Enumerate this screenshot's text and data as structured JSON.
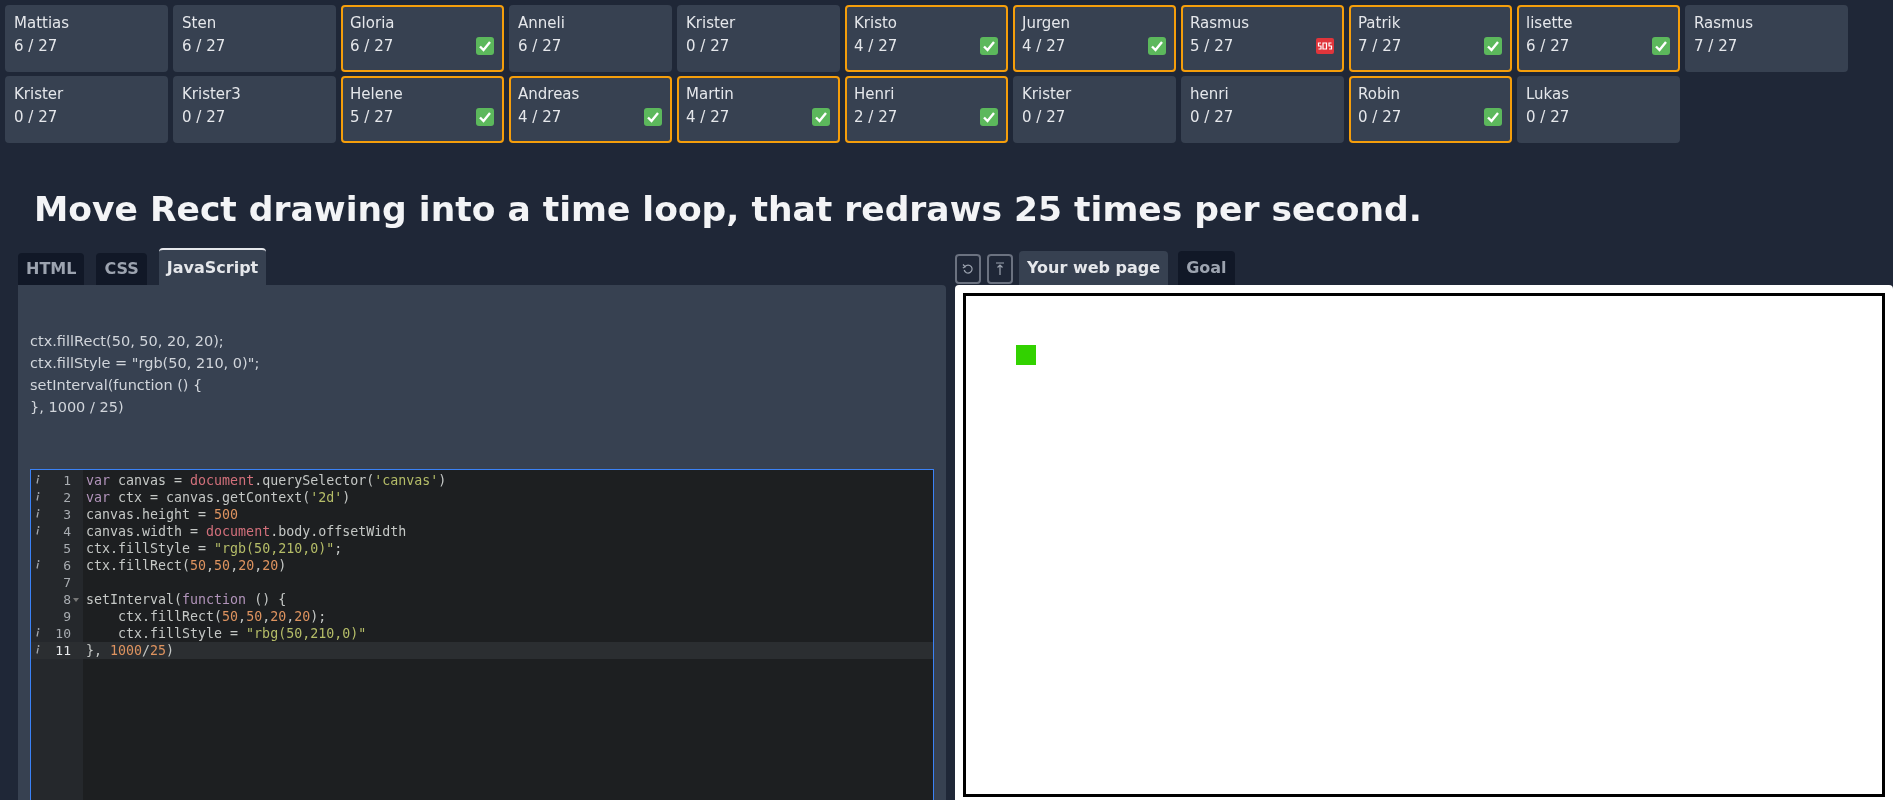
{
  "students": [
    {
      "name": "Mattias",
      "score": "6 / 27",
      "done": false,
      "help": false
    },
    {
      "name": "Sten",
      "score": "6 / 27",
      "done": false,
      "help": false
    },
    {
      "name": "Gloria",
      "score": "6 / 27",
      "done": true,
      "help": false
    },
    {
      "name": "Anneli",
      "score": "6 / 27",
      "done": false,
      "help": false
    },
    {
      "name": "Krister",
      "score": "0 / 27",
      "done": false,
      "help": false
    },
    {
      "name": "Kristo",
      "score": "4 / 27",
      "done": true,
      "help": false
    },
    {
      "name": "Jurgen",
      "score": "4 / 27",
      "done": true,
      "help": false
    },
    {
      "name": "Rasmus",
      "score": "5 / 27",
      "done": false,
      "help": true
    },
    {
      "name": "Patrik",
      "score": "7 / 27",
      "done": true,
      "help": false
    },
    {
      "name": "lisette",
      "score": "6 / 27",
      "done": true,
      "help": false
    },
    {
      "name": "Rasmus",
      "score": "7 / 27",
      "done": false,
      "help": false
    },
    {
      "name": "Krister",
      "score": "0 / 27",
      "done": false,
      "help": false
    },
    {
      "name": "Krister3",
      "score": "0 / 27",
      "done": false,
      "help": false
    },
    {
      "name": "Helene",
      "score": "5 / 27",
      "done": true,
      "help": false
    },
    {
      "name": "Andreas",
      "score": "4 / 27",
      "done": true,
      "help": false
    },
    {
      "name": "Martin",
      "score": "4 / 27",
      "done": true,
      "help": false
    },
    {
      "name": "Henri",
      "score": "2 / 27",
      "done": true,
      "help": false
    },
    {
      "name": "Krister",
      "score": "0 / 27",
      "done": false,
      "help": false
    },
    {
      "name": "henri",
      "score": "0 / 27",
      "done": false,
      "help": false
    },
    {
      "name": "Robin",
      "score": "0 / 27",
      "done": true,
      "help": false
    },
    {
      "name": "Lukas",
      "score": "0 / 27",
      "done": false,
      "help": false
    }
  ],
  "task_title": "Move Rect drawing into a time loop, that redraws 25 times per second.",
  "editor_tabs": [
    {
      "label": "HTML",
      "selected": false
    },
    {
      "label": "CSS",
      "selected": false
    },
    {
      "label": "JavaScript",
      "selected": true
    }
  ],
  "snippet": [
    "ctx.fillRect(50, 50, 20, 20);",
    "ctx.fillStyle = \"rgb(50, 210, 0)\";",
    "setInterval(function () {",
    "}, 1000 / 25)"
  ],
  "code_lines": [
    {
      "number": "1",
      "info": true,
      "fold": false,
      "active": false,
      "tokens": [
        {
          "kind": "keyword",
          "text": "var"
        },
        {
          "kind": "plain",
          "text": " canvas = "
        },
        {
          "kind": "builtin",
          "text": "document"
        },
        {
          "kind": "plain",
          "text": ".querySelector("
        },
        {
          "kind": "string",
          "text": "'canvas'"
        },
        {
          "kind": "plain",
          "text": ")"
        }
      ]
    },
    {
      "number": "2",
      "info": true,
      "fold": false,
      "active": false,
      "tokens": [
        {
          "kind": "keyword",
          "text": "var"
        },
        {
          "kind": "plain",
          "text": " ctx = canvas.getContext("
        },
        {
          "kind": "string",
          "text": "'2d'"
        },
        {
          "kind": "plain",
          "text": ")"
        }
      ]
    },
    {
      "number": "3",
      "info": true,
      "fold": false,
      "active": false,
      "tokens": [
        {
          "kind": "plain",
          "text": "canvas.height = "
        },
        {
          "kind": "number",
          "text": "500"
        }
      ]
    },
    {
      "number": "4",
      "info": true,
      "fold": false,
      "active": false,
      "tokens": [
        {
          "kind": "plain",
          "text": "canvas.width = "
        },
        {
          "kind": "builtin",
          "text": "document"
        },
        {
          "kind": "plain",
          "text": ".body.offsetWidth"
        }
      ]
    },
    {
      "number": "5",
      "info": false,
      "fold": false,
      "active": false,
      "tokens": [
        {
          "kind": "plain",
          "text": "ctx.fillStyle = "
        },
        {
          "kind": "string",
          "text": "\"rgb(50,210,0)\""
        },
        {
          "kind": "plain",
          "text": ";"
        }
      ]
    },
    {
      "number": "6",
      "info": true,
      "fold": false,
      "active": false,
      "tokens": [
        {
          "kind": "plain",
          "text": "ctx.fillRect("
        },
        {
          "kind": "number",
          "text": "50"
        },
        {
          "kind": "plain",
          "text": ","
        },
        {
          "kind": "number",
          "text": "50"
        },
        {
          "kind": "plain",
          "text": ","
        },
        {
          "kind": "number",
          "text": "20"
        },
        {
          "kind": "plain",
          "text": ","
        },
        {
          "kind": "number",
          "text": "20"
        },
        {
          "kind": "plain",
          "text": ")"
        }
      ]
    },
    {
      "number": "7",
      "info": false,
      "fold": false,
      "active": false
    },
    {
      "number": "8",
      "info": false,
      "fold": true,
      "active": false,
      "tokens": [
        {
          "kind": "plain",
          "text": "setInterval("
        },
        {
          "kind": "keyword",
          "text": "function"
        },
        {
          "kind": "plain",
          "text": " () {"
        }
      ]
    },
    {
      "number": "9",
      "info": false,
      "fold": false,
      "active": false,
      "tokens": [
        {
          "kind": "plain",
          "text": "    ctx.fillRect("
        },
        {
          "kind": "number",
          "text": "50"
        },
        {
          "kind": "plain",
          "text": ","
        },
        {
          "kind": "number",
          "text": "50"
        },
        {
          "kind": "plain",
          "text": ","
        },
        {
          "kind": "number",
          "text": "20"
        },
        {
          "kind": "plain",
          "text": ","
        },
        {
          "kind": "number",
          "text": "20"
        },
        {
          "kind": "plain",
          "text": ");"
        }
      ]
    },
    {
      "number": "10",
      "info": true,
      "fold": false,
      "active": false,
      "tokens": [
        {
          "kind": "plain",
          "text": "    ctx.fillStyle = "
        },
        {
          "kind": "string",
          "text": "\"rbg(50,210,0)\""
        }
      ]
    },
    {
      "number": "11",
      "info": true,
      "fold": false,
      "active": true,
      "tokens": [
        {
          "kind": "plain",
          "text": "}, "
        },
        {
          "kind": "number",
          "text": "1000"
        },
        {
          "kind": "plain",
          "text": "/"
        },
        {
          "kind": "number",
          "text": "25"
        },
        {
          "kind": "plain",
          "text": ")"
        }
      ]
    }
  ],
  "preview_tabs": [
    {
      "label": "Your web page",
      "selected": true
    },
    {
      "label": "Goal",
      "selected": false
    }
  ]
}
